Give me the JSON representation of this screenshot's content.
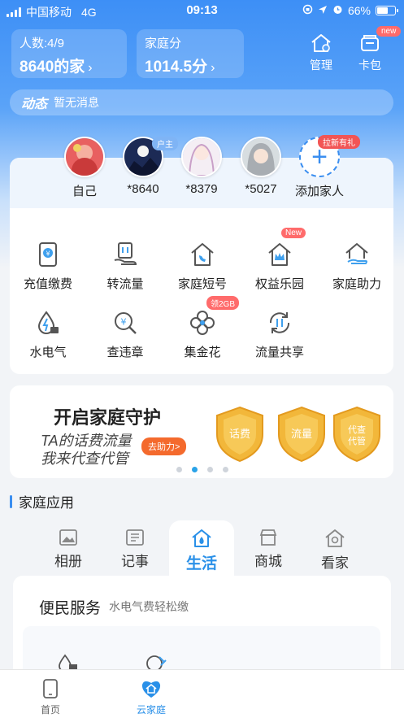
{
  "status_bar": {
    "carrier": "中国移动",
    "network": "4G",
    "time": "09:13",
    "battery": "66%",
    "battery_level": 0.66
  },
  "header": {
    "members_label": "人数:4/9",
    "family_name": "8640的家",
    "score_label": "家庭分",
    "score_value": "1014.5分",
    "manage_label": "管理",
    "wallet_label": "卡包",
    "wallet_badge": "new"
  },
  "news": {
    "tag": "动态",
    "text": "暂无消息"
  },
  "members": {
    "items": [
      {
        "name": "自己"
      },
      {
        "name": "*8640",
        "badge": "户主"
      },
      {
        "name": "*8379"
      },
      {
        "name": "*5027"
      }
    ],
    "add_label": "添加家人",
    "add_badge": "拉新有礼",
    "add_symbol": "+"
  },
  "services": [
    {
      "label": "充值缴费",
      "icon": "recharge-icon"
    },
    {
      "label": "转流量",
      "icon": "transfer-data-icon"
    },
    {
      "label": "家庭短号",
      "icon": "family-short-number-icon"
    },
    {
      "label": "权益乐园",
      "icon": "benefits-park-icon",
      "badge": "New"
    },
    {
      "label": "家庭助力",
      "icon": "family-help-icon"
    },
    {
      "label": "水电气",
      "icon": "utilities-icon"
    },
    {
      "label": "查违章",
      "icon": "traffic-violation-icon"
    },
    {
      "label": "集金花",
      "icon": "gold-flower-icon",
      "badge": "领2GB"
    },
    {
      "label": "流量共享",
      "icon": "data-share-icon"
    }
  ],
  "banner": {
    "title": "开启家庭守护",
    "line1": "TA的话费流量",
    "line2": "我来代查代管",
    "button": "去助力>",
    "shields": [
      "话费",
      "流量",
      "代查\n代管"
    ],
    "page_count": 4,
    "active_page": 1
  },
  "family_apps": {
    "title": "家庭应用",
    "tabs": [
      {
        "label": "相册",
        "icon": "photo-album-icon"
      },
      {
        "label": "记事",
        "icon": "notes-icon"
      },
      {
        "label": "生活",
        "icon": "life-icon",
        "active": true
      },
      {
        "label": "商城",
        "icon": "store-icon"
      },
      {
        "label": "看家",
        "icon": "home-camera-icon"
      }
    ]
  },
  "panel": {
    "title": "便民服务",
    "subtitle": "水电气费轻松缴"
  },
  "bottom_nav": {
    "home": "首页",
    "cloud_family": "云家庭"
  },
  "colors": {
    "accent": "#2a90e8",
    "badge_red": "#f25555",
    "shield_gold": "#f2b73a"
  }
}
